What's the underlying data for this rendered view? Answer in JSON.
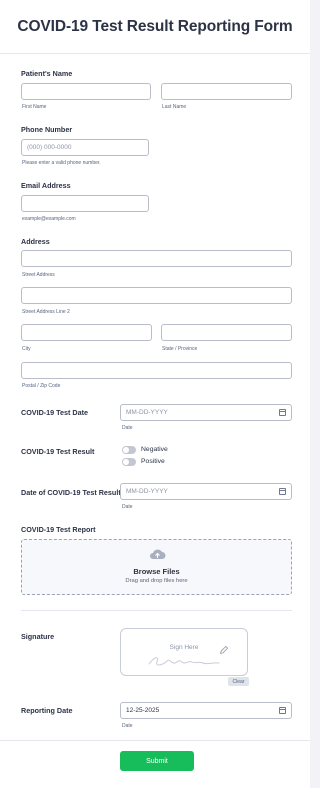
{
  "form": {
    "title": "COVID-19 Test Result Reporting Form"
  },
  "patient_name": {
    "label": "Patient's Name",
    "first_sub": "First Name",
    "last_sub": "Last Name",
    "first_value": "",
    "last_value": ""
  },
  "phone": {
    "label": "Phone Number",
    "placeholder": "(000) 000-0000",
    "sub": "Please enter a valid phone number."
  },
  "email": {
    "label": "Email Address",
    "sub": "example@example.com"
  },
  "address": {
    "label": "Address",
    "street_sub": "Street Address",
    "street2_sub": "Street Address Line 2",
    "city_sub": "City",
    "state_sub": "State / Province",
    "zip_sub": "Postal / Zip Code"
  },
  "test_date": {
    "label": "COVID-19 Test Date",
    "placeholder": "MM-DD-YYYY",
    "sub": "Date"
  },
  "test_result": {
    "label": "COVID-19 Test Result",
    "options": [
      "Negative",
      "Positive"
    ]
  },
  "result_date": {
    "label": "Date of COVID-19 Test Result",
    "placeholder": "MM-DD-YYYY",
    "sub": "Date"
  },
  "report": {
    "label": "COVID-19 Test Report",
    "browse": "Browse Files",
    "drag": "Drag and drop files here",
    "icon": "cloud-upload-icon"
  },
  "signature": {
    "label": "Signature",
    "hint": "Sign Here",
    "clear": "Clear",
    "icon": "pen-icon"
  },
  "reporting_date": {
    "label": "Reporting Date",
    "value": "12-25-2025",
    "sub": "Date"
  },
  "actions": {
    "submit": "Submit"
  },
  "colors": {
    "submit": "#18bd5b",
    "text": "#2c3345",
    "border": "#b8bdc9"
  }
}
